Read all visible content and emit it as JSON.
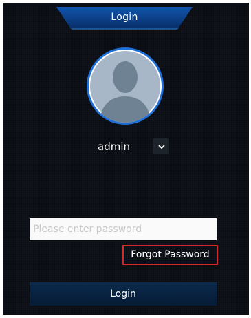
{
  "header": {
    "title": "Login"
  },
  "user": {
    "avatar_icon": "user-avatar-icon",
    "username": "admin",
    "dropdown_icon": "chevron-down-icon"
  },
  "password": {
    "value": "",
    "placeholder": "Please enter password"
  },
  "forgot_password": {
    "label": "Forgot Password"
  },
  "login_button": {
    "label": "Login"
  },
  "colors": {
    "background": "#0a0e14",
    "title_bar": "#0a3f8a",
    "avatar_ring": "#1e6fd8",
    "avatar_fill": "#a8b8c8",
    "highlight_border": "#d42a2a",
    "button": "#072340"
  }
}
